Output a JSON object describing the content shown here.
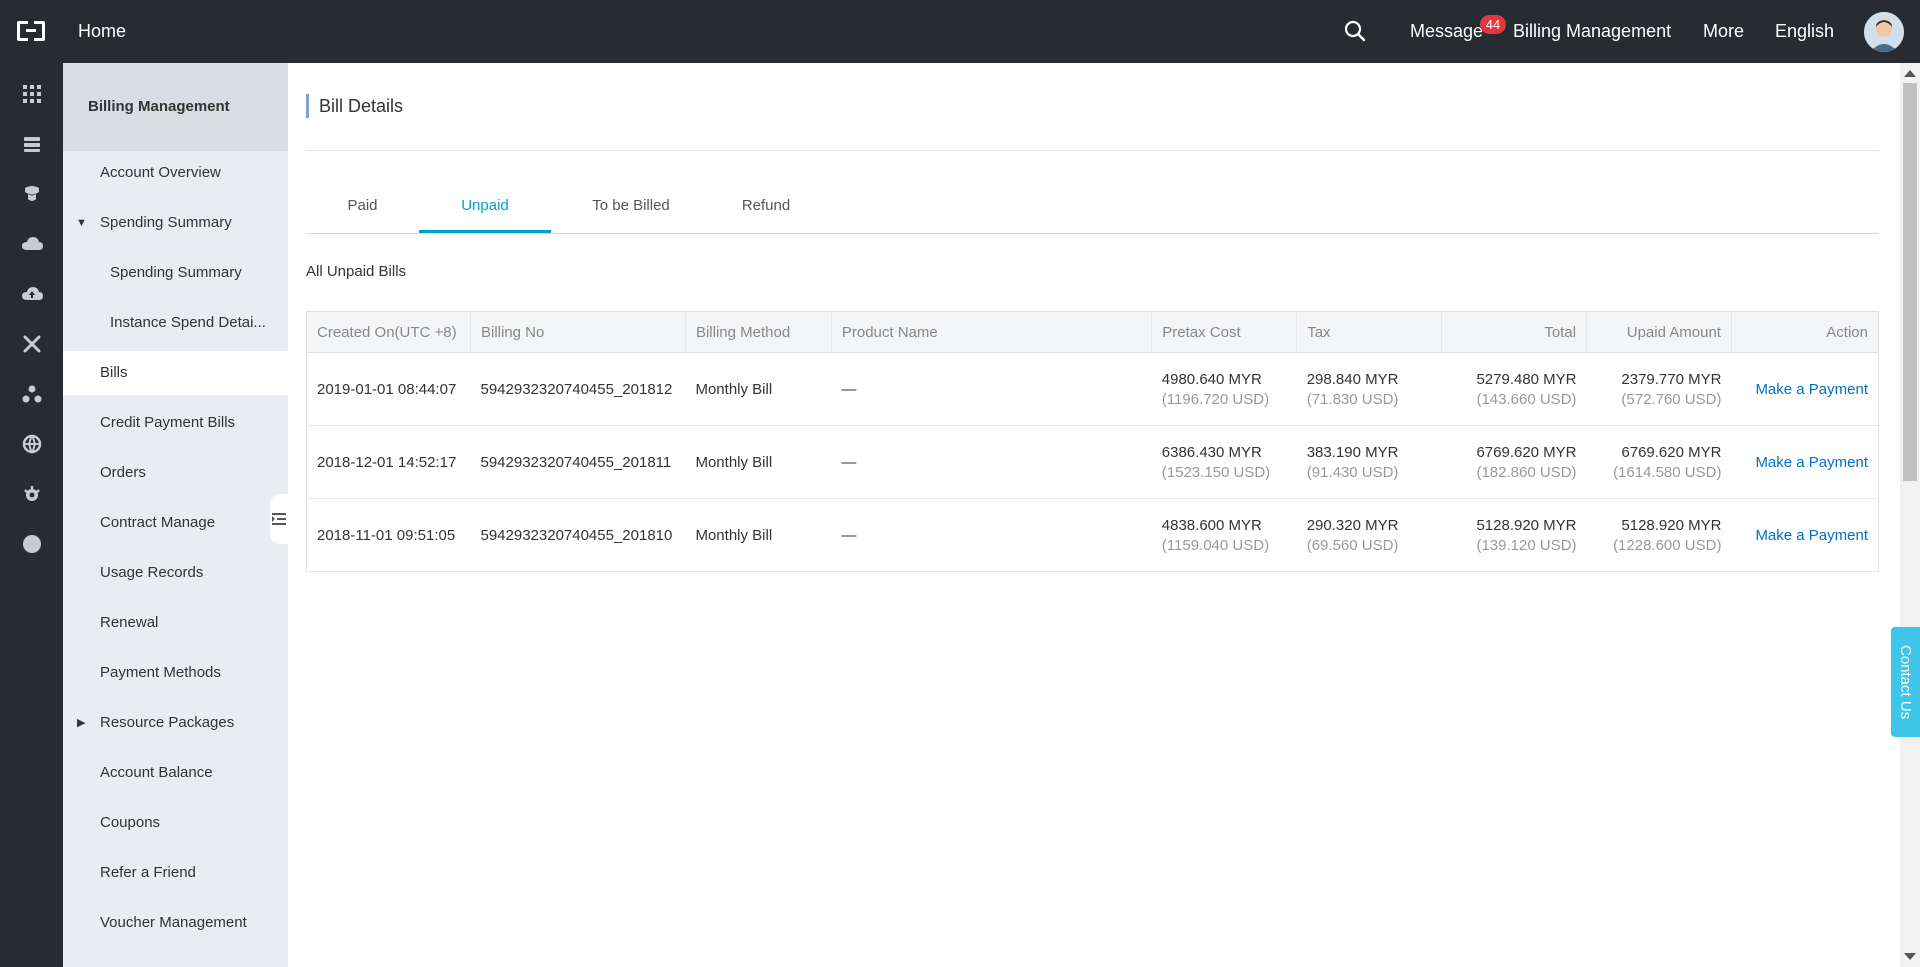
{
  "topbar": {
    "home": "Home",
    "message": "Message",
    "message_count": "44",
    "billing_management": "Billing Management",
    "more": "More",
    "language": "English"
  },
  "rail_icons": [
    "grid-icon",
    "server-icon",
    "database-icon",
    "cloud-icon",
    "cloud-upload-icon",
    "tools-icon",
    "network-icon",
    "globe-icon",
    "gear-icon",
    "circle-icon"
  ],
  "sidebar": {
    "title": "Billing Management",
    "items": [
      {
        "label": "Account Overview"
      },
      {
        "label": "Spending Summary"
      },
      {
        "label": "Spending Summary"
      },
      {
        "label": "Instance Spend Detai..."
      },
      {
        "label": "Bills"
      },
      {
        "label": "Credit Payment Bills"
      },
      {
        "label": "Orders"
      },
      {
        "label": "Contract Manage"
      },
      {
        "label": "Usage Records"
      },
      {
        "label": "Renewal"
      },
      {
        "label": "Payment Methods"
      },
      {
        "label": "Resource Packages"
      },
      {
        "label": "Account Balance"
      },
      {
        "label": "Coupons"
      },
      {
        "label": "Refer a Friend"
      },
      {
        "label": "Voucher Management"
      }
    ]
  },
  "main": {
    "title": "Bill Details",
    "tabs": [
      {
        "label": "Paid"
      },
      {
        "label": "Unpaid"
      },
      {
        "label": "To be Billed"
      },
      {
        "label": "Refund"
      }
    ],
    "active_tab": "Unpaid",
    "subtitle": "All Unpaid Bills",
    "columns": [
      "Created On(UTC +8)",
      "Billing No",
      "Billing Method",
      "Product Name",
      "Pretax Cost",
      "Tax",
      "Total",
      "Upaid Amount",
      "Action"
    ],
    "rows": [
      {
        "created": "2019-01-01 08:44:07",
        "billing_no": "5942932320740455_201812",
        "method": "Monthly Bill",
        "product": "—",
        "pretax": "4980.640 MYR",
        "pretax_usd": "(1196.720 USD)",
        "tax": "298.840 MYR",
        "tax_usd": "(71.830 USD)",
        "total": "5279.480 MYR",
        "total_usd": "(143.660 USD)",
        "unpaid": "2379.770 MYR",
        "unpaid_usd": "(572.760 USD)",
        "action": "Make a Payment"
      },
      {
        "created": "2018-12-01 14:52:17",
        "billing_no": "5942932320740455_201811",
        "method": "Monthly Bill",
        "product": "—",
        "pretax": "6386.430 MYR",
        "pretax_usd": "(1523.150 USD)",
        "tax": "383.190 MYR",
        "tax_usd": "(91.430 USD)",
        "total": "6769.620 MYR",
        "total_usd": "(182.860 USD)",
        "unpaid": "6769.620 MYR",
        "unpaid_usd": "(1614.580 USD)",
        "action": "Make a Payment"
      },
      {
        "created": "2018-11-01 09:51:05",
        "billing_no": "5942932320740455_201810",
        "method": "Monthly Bill",
        "product": "—",
        "pretax": "4838.600 MYR",
        "pretax_usd": "(1159.040 USD)",
        "tax": "290.320 MYR",
        "tax_usd": "(69.560 USD)",
        "total": "5128.920 MYR",
        "total_usd": "(139.120 USD)",
        "unpaid": "5128.920 MYR",
        "unpaid_usd": "(1228.600 USD)",
        "action": "Make a Payment"
      }
    ]
  },
  "contact_us": "Contact Us",
  "colors": {
    "accent": "#00a2ca",
    "link": "#0070cc",
    "topbar": "#272c33",
    "badge": "#e4393c",
    "contact": "#3fc5ea"
  }
}
